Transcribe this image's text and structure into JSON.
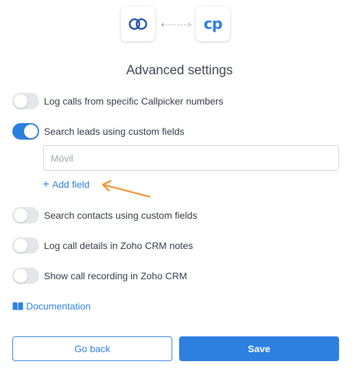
{
  "header": {
    "left_logo_icon": "zoho-crm-logo-icon",
    "right_logo_text": "cp",
    "connector_icon": "dashed-arrow-icon"
  },
  "title": "Advanced settings",
  "settings": [
    {
      "label": "Log calls from specific Callpicker numbers",
      "enabled": false
    },
    {
      "label": "Search leads using custom fields",
      "enabled": true
    },
    {
      "label": "Search contacts using custom fields",
      "enabled": false
    },
    {
      "label": "Log call details in Zoho CRM notes",
      "enabled": false
    },
    {
      "label": "Show call recording in Zoho CRM",
      "enabled": false
    }
  ],
  "custom_field": {
    "placeholder": "Móvil",
    "value": ""
  },
  "add_field": {
    "icon": "plus-icon",
    "label": "Add field"
  },
  "annotation": {
    "icon": "orange-arrow-icon",
    "color": "#f5922f"
  },
  "documentation": {
    "icon": "book-icon",
    "label": "Documentation"
  },
  "buttons": {
    "back_label": "Go back",
    "save_label": "Save"
  },
  "colors": {
    "accent": "#2d7fe0",
    "toggle_off": "#e4e6ea",
    "annotation": "#f5922f"
  }
}
